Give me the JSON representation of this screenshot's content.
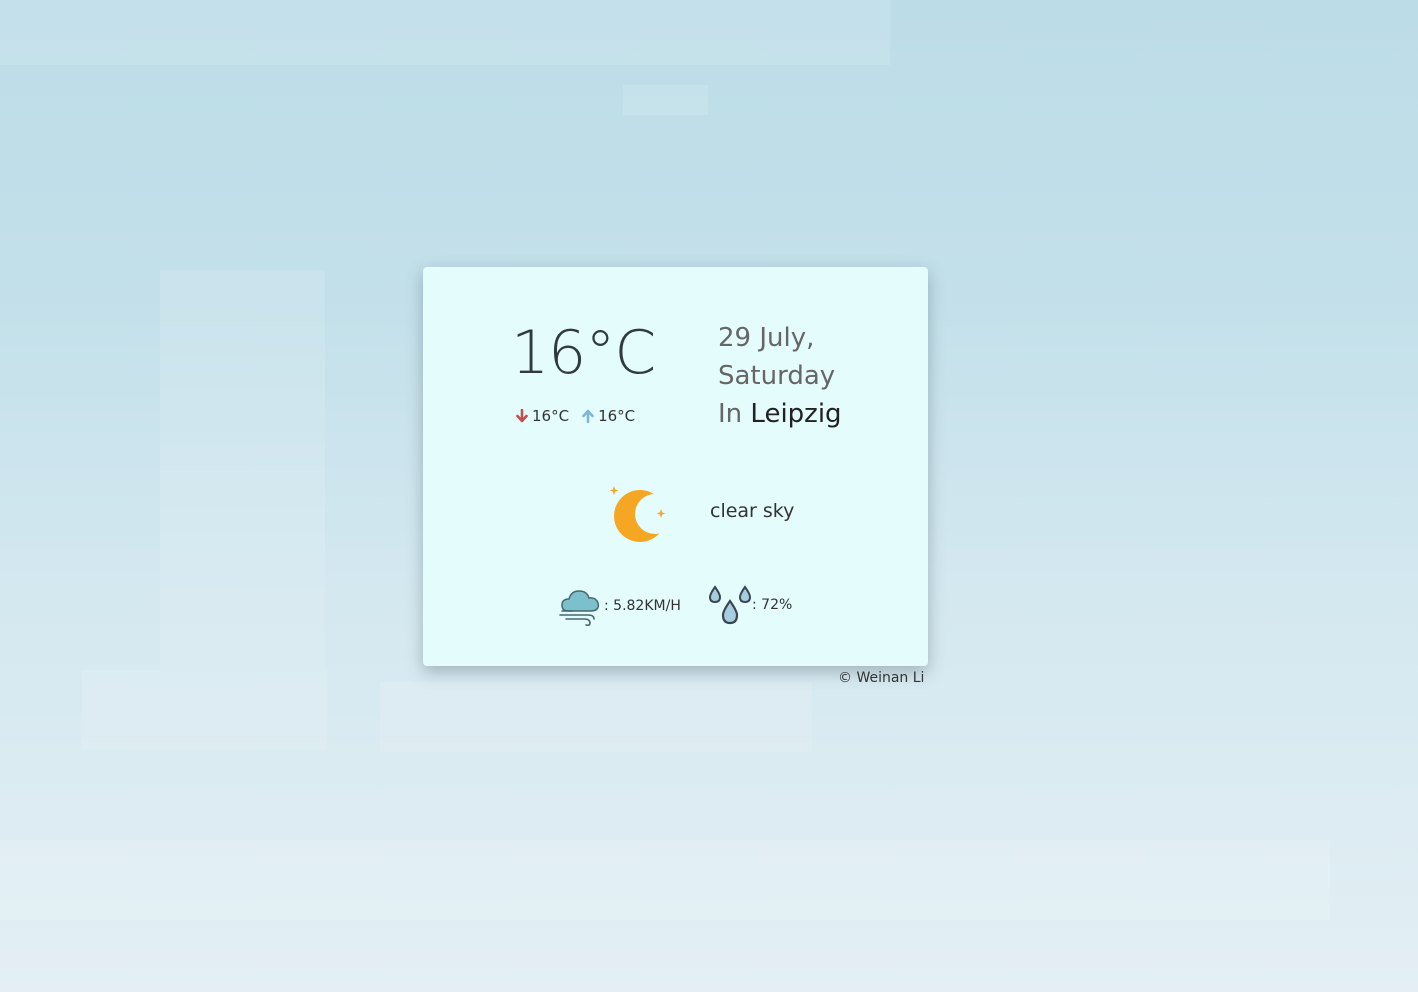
{
  "weather": {
    "temperature": "16°C",
    "temp_min": "16°C",
    "temp_max": "16°C",
    "date": "29 July,",
    "weekday": "Saturday",
    "location_prefix": "In",
    "city": "Leipzig",
    "description": "clear sky",
    "wind_speed": ": 5.82KM/H",
    "humidity": ": 72%",
    "icon": "moon-stars-icon"
  },
  "footer": {
    "copyright": "© Weinan Li"
  },
  "colors": {
    "card_bg": "#e4fcfc",
    "down_arrow": "#c0504d",
    "up_arrow": "#7fb7d8",
    "moon": "#f5a623"
  }
}
